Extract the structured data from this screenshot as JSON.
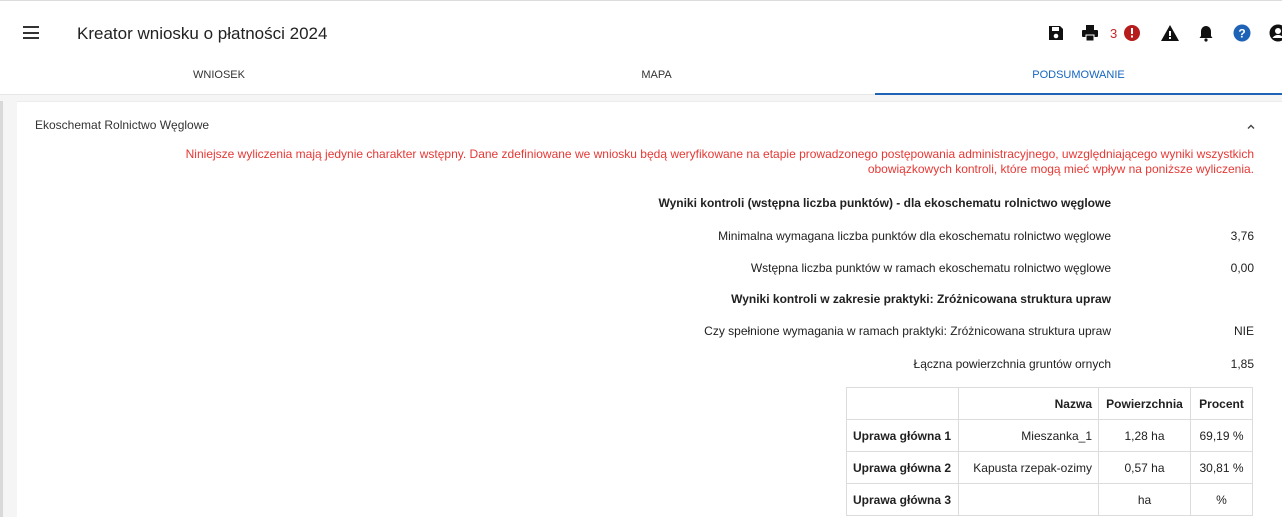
{
  "header": {
    "title": "Kreator wniosku o płatności 2024",
    "error_count": "3"
  },
  "tabs": [
    {
      "label": "WNIOSEK"
    },
    {
      "label": "MAPA"
    },
    {
      "label": "PODSUMOWANIE",
      "active": true
    }
  ],
  "section": {
    "title": "Ekoschemat Rolnictwo Węglowe",
    "notice_line1": "Niniejsze wyliczenia mają jedynie charakter wstępny. Dane zdefiniowane we wniosku będą weryfikowane na etapie prowadzonego postępowania administracyjnego, uwzględniającego wyniki wszystkich",
    "notice_line2": "obowiązkowych kontroli, które mogą mieć wpływ na poniższe wyliczenia."
  },
  "results": {
    "heading1": "Wyniki kontroli (wstępna liczba punktów) - dla ekoschematu rolnictwo węglowe",
    "min_points_label": "Minimalna wymagana liczba punktów dla ekoschematu rolnictwo węglowe",
    "min_points_value": "3,76",
    "initial_points_label": "Wstępna liczba punktów w ramach ekoschematu rolnictwo węglowe",
    "initial_points_value": "0,00",
    "heading2": "Wyniki kontroli w zakresie praktyki: Zróżnicowana struktura upraw",
    "requirements_label": "Czy spełnione wymagania w ramach praktyki: Zróżnicowana struktura upraw",
    "requirements_value": "NIE",
    "arable_area_label": "Łączna powierzchnia gruntów ornych",
    "arable_area_value": "1,85"
  },
  "crops_table": {
    "headers": [
      "",
      "Nazwa",
      "Powierzchnia",
      "Procent"
    ],
    "rows": [
      {
        "label": "Uprawa główna 1",
        "name": "Mieszanka_1",
        "area": "1,28 ha",
        "percent": "69,19 %"
      },
      {
        "label": "Uprawa główna 2",
        "name": "Kapusta rzepak-ozimy",
        "area": "0,57 ha",
        "percent": "30,81 %"
      },
      {
        "label": "Uprawa główna 3",
        "name": "",
        "area": "ha",
        "percent": "%"
      }
    ]
  },
  "colors": {
    "accent": "#1e63b6",
    "warning_text": "#e53935",
    "error_badge": "#c62828"
  },
  "icons": [
    "menu-icon",
    "save-icon",
    "print-icon",
    "error-icon",
    "warning-icon",
    "bell-icon",
    "help-icon",
    "user-icon",
    "chevron-up-icon"
  ]
}
